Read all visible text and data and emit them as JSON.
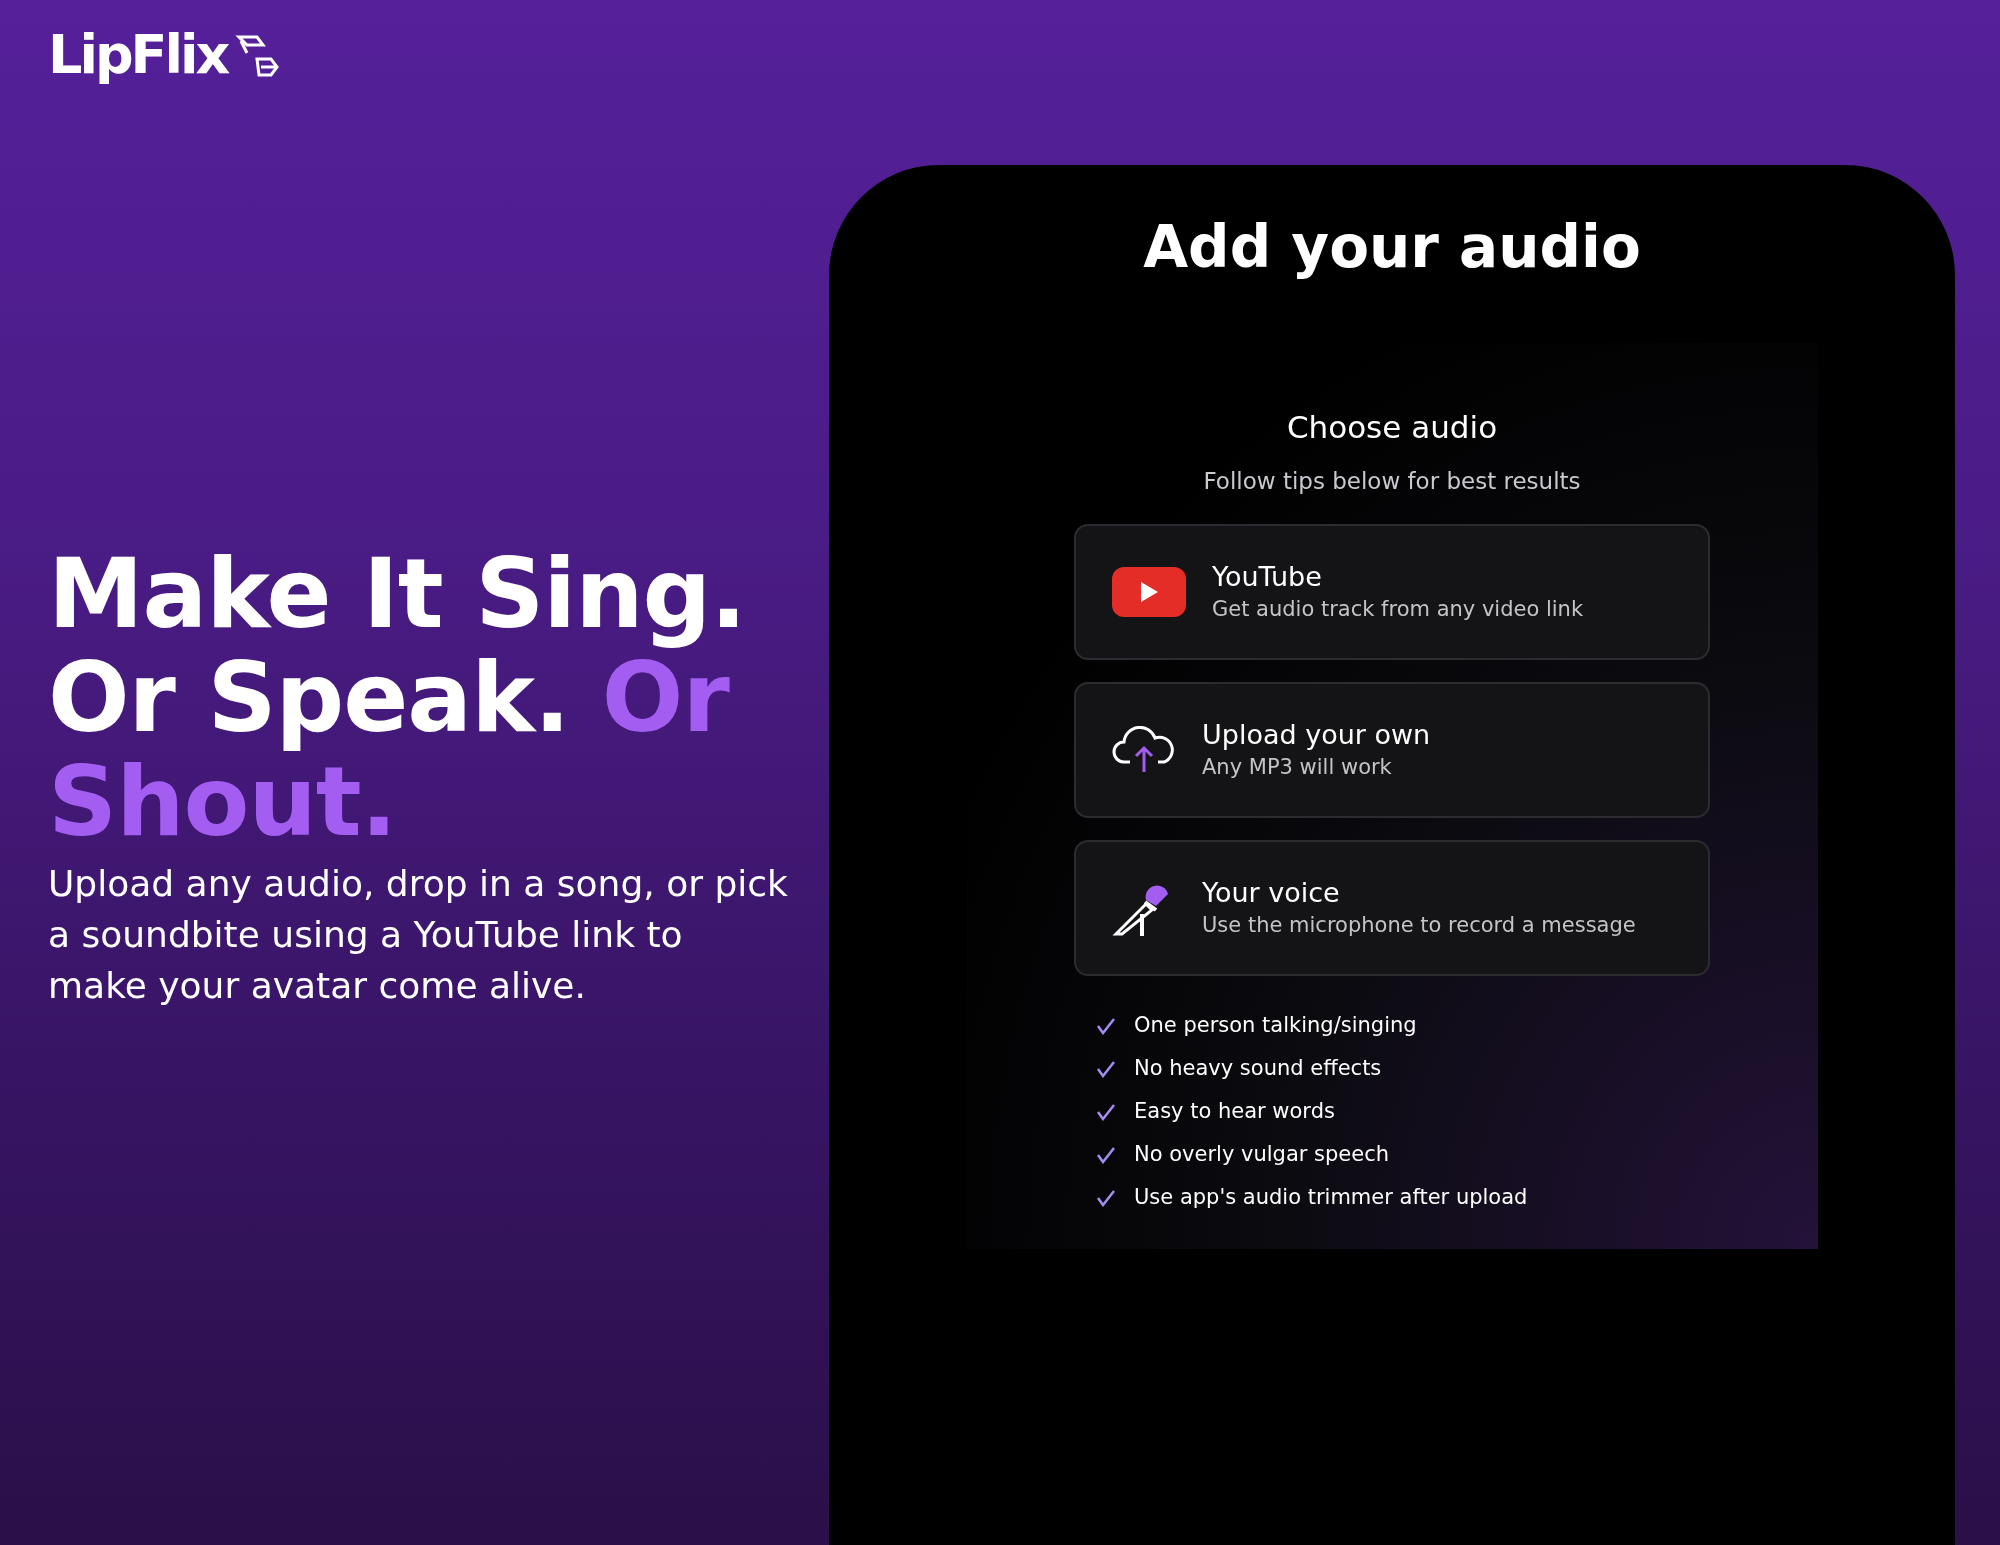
{
  "logo": {
    "text": "LipFlix"
  },
  "hero": {
    "headline": "Make It Sing. Or Speak.",
    "headline_accent": "Or Shout.",
    "description": "Upload any audio, drop in a song, or pick a soundbite using a YouTube link to make your avatar come alive."
  },
  "phone": {
    "title": "Add your audio",
    "heading": "Choose audio",
    "subheading": "Follow tips below for best results",
    "options": [
      {
        "kind": "youtube",
        "title": "YouTube",
        "subtitle": "Get audio track from any video link"
      },
      {
        "kind": "upload",
        "title": "Upload your own",
        "subtitle": "Any MP3 will work"
      },
      {
        "kind": "voice",
        "title": "Your voice",
        "subtitle": "Use the microphone to record a message"
      }
    ],
    "tips": [
      "One person talking/singing",
      "No heavy sound effects",
      "Easy to hear words",
      "No overly vulgar speech",
      "Use app's audio trimmer after upload"
    ]
  }
}
